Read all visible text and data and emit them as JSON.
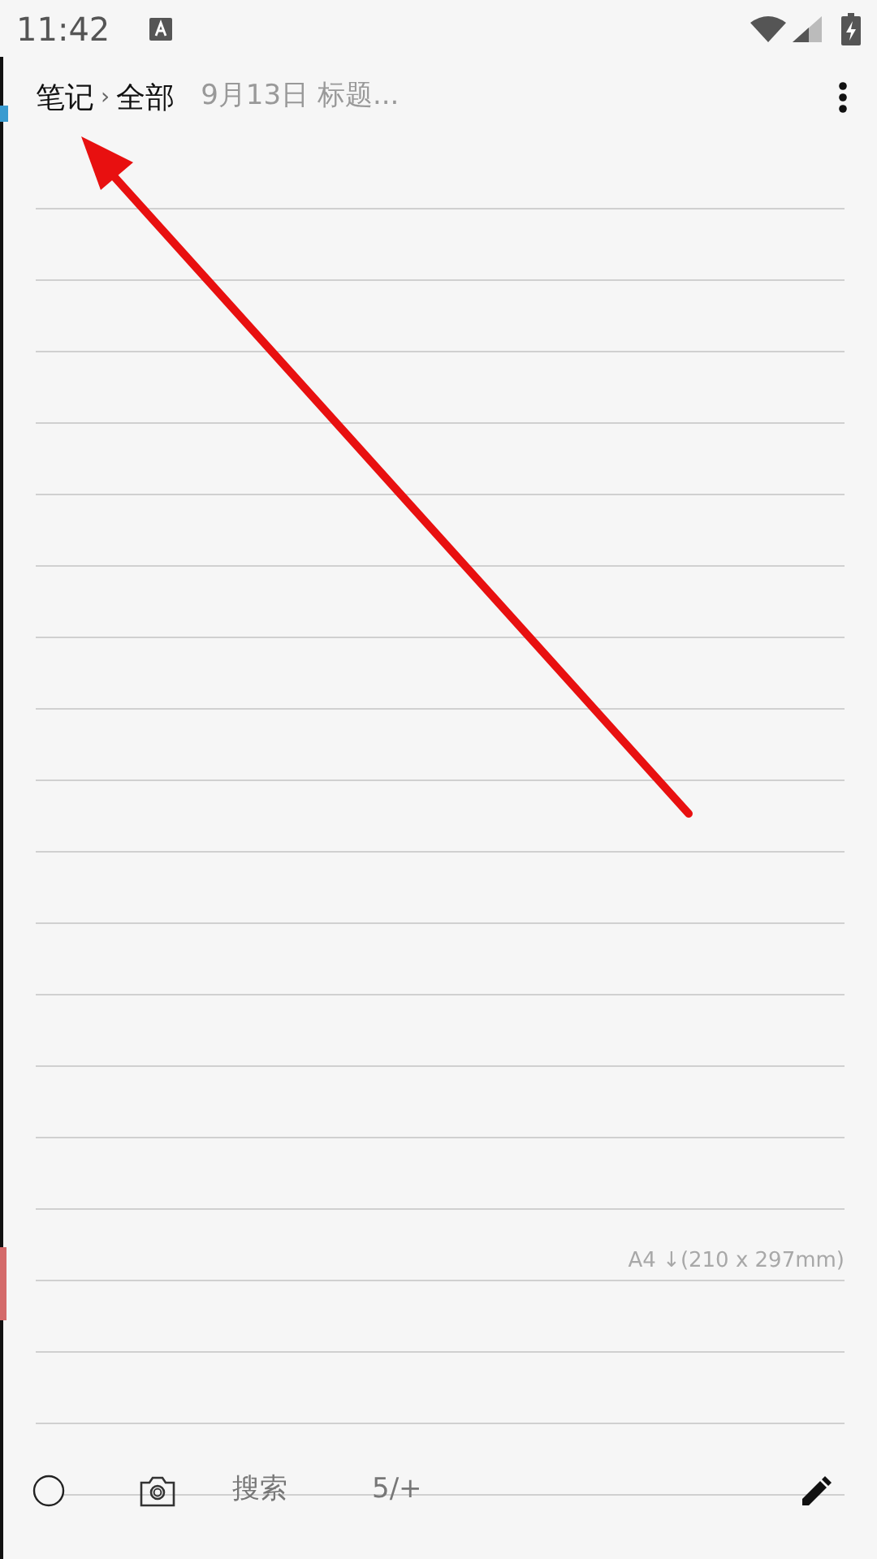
{
  "status_bar": {
    "time": "11:42"
  },
  "header": {
    "breadcrumb": [
      "笔记",
      "全部"
    ],
    "separator": "›",
    "subtitle": "9月13日 标题..."
  },
  "page": {
    "size_label": "A4 ↓(210 x 297mm)"
  },
  "toolbar": {
    "search": "搜索",
    "page_counter": "5/+"
  }
}
